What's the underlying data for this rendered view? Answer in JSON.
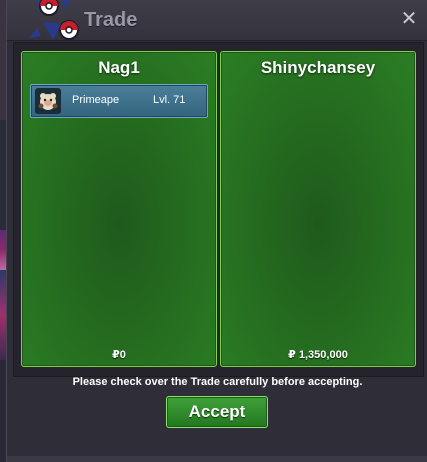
{
  "window": {
    "title": "Trade",
    "close_icon": "close-icon"
  },
  "left_panel": {
    "player_name": "Nag1",
    "items": [
      {
        "name": "Primeape",
        "level": "Lvl. 71",
        "icon": "primeape-sprite-icon"
      }
    ],
    "money": "₽0"
  },
  "right_panel": {
    "player_name": "Shinychansey",
    "items": [],
    "money": "₽ 1,350,000"
  },
  "footer": {
    "notice": "Please check over the Trade carefully before accepting.",
    "accept_label": "Accept"
  },
  "colors": {
    "panel_green": "#2b7e24",
    "panel_border": "#7fd04a",
    "item_blue": "#4a7f9a",
    "accept_green": "#3fa13a",
    "window_bg": "#2f2d38"
  }
}
